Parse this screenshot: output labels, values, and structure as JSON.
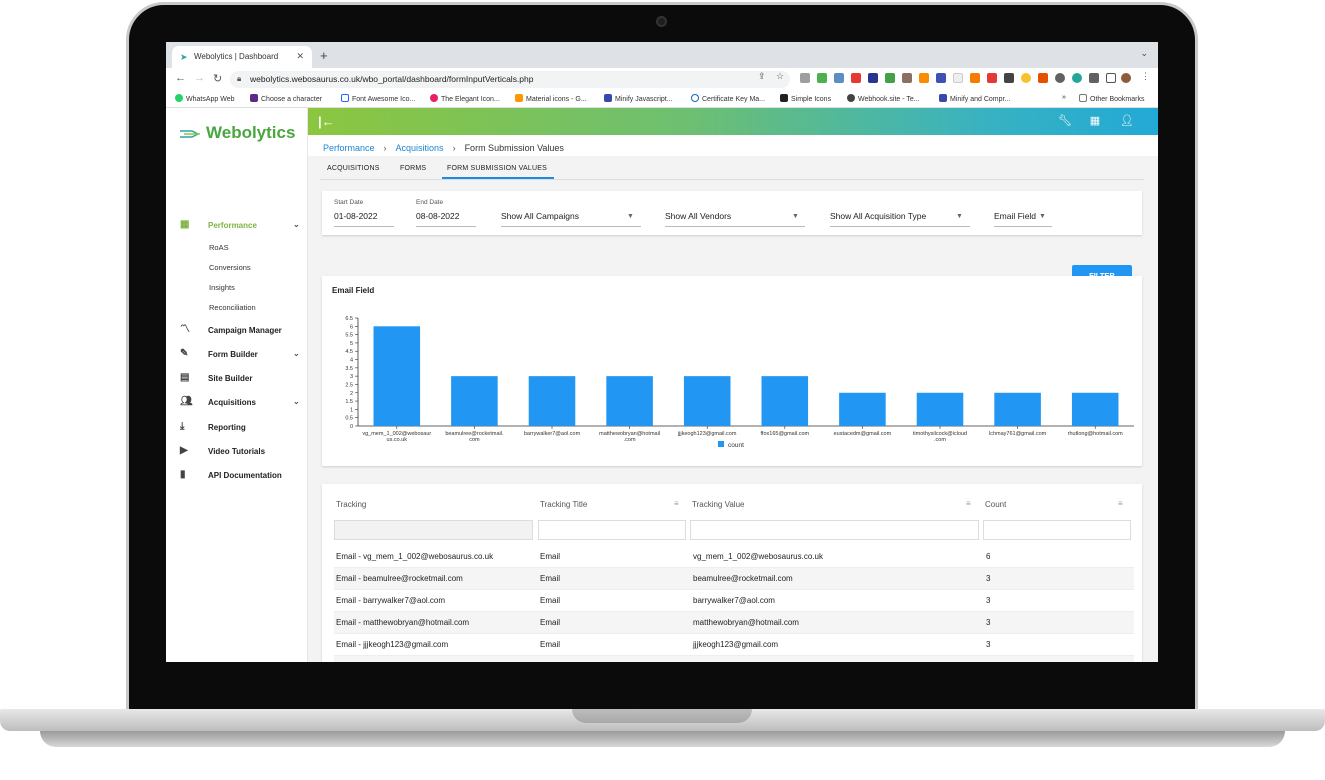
{
  "browser": {
    "tab_title": "Webolytics | Dashboard",
    "url": "webolytics.webosaurus.co.uk/wbo_portal/dashboard/formInputVerticals.php",
    "bookmarks": [
      "WhatsApp Web",
      "Choose a character",
      "Font Awesome Ico...",
      "The Elegant Icon...",
      "Material icons - G...",
      "Minify Javascript...",
      "Certificate Key Ma...",
      "Simple Icons",
      "Webhook.site - Te...",
      "Minify and Compr..."
    ],
    "other_bookmarks": "Other Bookmarks",
    "bookmarks_overflow": "»"
  },
  "app": {
    "logo": "Webolytics",
    "accent": "#1e88e5"
  },
  "sidebar": {
    "items": [
      {
        "label": "Performance",
        "icon": "performance-icon",
        "active": true
      },
      {
        "label": "Campaign Manager",
        "icon": "trend-icon"
      },
      {
        "label": "Form Builder",
        "icon": "form-icon"
      },
      {
        "label": "Site Builder",
        "icon": "site-icon"
      },
      {
        "label": "Acquisitions",
        "icon": "people-icon"
      },
      {
        "label": "Reporting",
        "icon": "download-icon"
      },
      {
        "label": "Video Tutorials",
        "icon": "video-icon"
      },
      {
        "label": "API Documentation",
        "icon": "book-icon"
      }
    ],
    "sub_items": [
      "RoAS",
      "Conversions",
      "Insights",
      "Reconciliation"
    ]
  },
  "breadcrumb": {
    "l1": "Performance",
    "l2": "Acquisitions",
    "current": "Form Submission Values"
  },
  "tabs": [
    "ACQUISITIONS",
    "FORMS",
    "FORM SUBMISSION VALUES"
  ],
  "filters": {
    "start_label": "Start Date",
    "start_value": "01-08-2022",
    "end_label": "End Date",
    "end_value": "08-08-2022",
    "campaigns": "Show All Campaigns",
    "vendors": "Show All Vendors",
    "acq_type": "Show All Acquisition Type",
    "field": "Email Field",
    "button": "FILTER"
  },
  "chart_data": {
    "type": "bar",
    "title": "Email Field",
    "categories": [
      "vg_mem_1_002@webosaur\nus.co.uk",
      "beamulree@rocketmail.\ncom",
      "barrywalker7@aol.com",
      "matthewobryan@hotmail\n.com",
      "jjjkeogh123@gmail.com",
      "ffox165@gmail.com",
      "eustacedm@gmail.com",
      "timothysilcock@icloud\n.com",
      "lchmay761@gmail.com",
      "rhutlong@hotmail.com"
    ],
    "series": [
      {
        "name": "count",
        "values": [
          6,
          3,
          3,
          3,
          3,
          3,
          2,
          2,
          2,
          2
        ]
      }
    ],
    "ylim": [
      0,
      6.5
    ],
    "yticks": [
      "0",
      "0.5",
      "1",
      "1.5",
      "2",
      "2.5",
      "3",
      "3.5",
      "4",
      "4.5",
      "5",
      "5.5",
      "6",
      "6.5"
    ],
    "color": "#2196f3",
    "legend": "bottom"
  },
  "table": {
    "headers": [
      "Tracking",
      "Tracking Title",
      "Tracking Value",
      "Count"
    ],
    "rows": [
      [
        "Email - vg_mem_1_002@webosaurus.co.uk",
        "Email",
        "vg_mem_1_002@webosaurus.co.uk",
        "6"
      ],
      [
        "Email - beamulree@rocketmail.com",
        "Email",
        "beamulree@rocketmail.com",
        "3"
      ],
      [
        "Email - barrywalker7@aol.com",
        "Email",
        "barrywalker7@aol.com",
        "3"
      ],
      [
        "Email - matthewobryan@hotmail.com",
        "Email",
        "matthewobryan@hotmail.com",
        "3"
      ],
      [
        "Email - jjjkeogh123@gmail.com",
        "Email",
        "jjjkeogh123@gmail.com",
        "3"
      ]
    ]
  }
}
